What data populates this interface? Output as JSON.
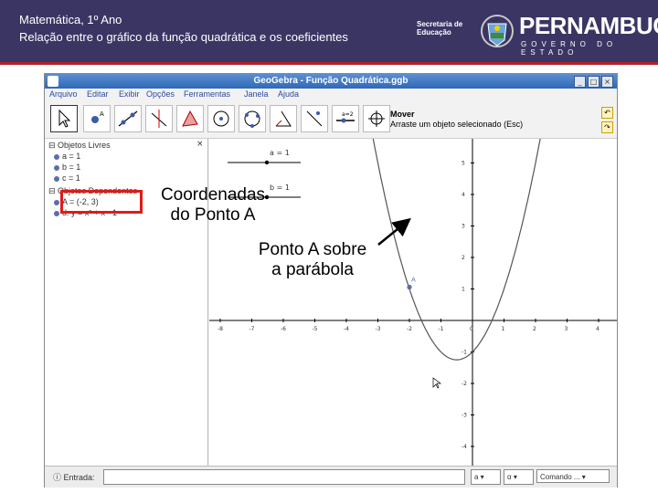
{
  "header": {
    "line1": "Matemática, 1º Ano",
    "line2": "Relação entre o gráfico da função quadrática e os coeficientes",
    "secretaria_line1": "Secretaria de",
    "secretaria_line2": "Educação",
    "brand": "PERNAMBUCO",
    "brand_sub": "GOVERNO DO ESTADO"
  },
  "window": {
    "title": "GeoGebra - Função Quadrática.ggb",
    "menu": [
      "Arquivo",
      "Editar",
      "Exibir",
      "Opções",
      "Ferramentas",
      "Janela",
      "Ajuda"
    ],
    "tool_title": "Mover",
    "tool_help": "Arraste um objeto selecionado (Esc)"
  },
  "algebra": {
    "free_header": "Objetos Livres",
    "free": [
      "a = 1",
      "b = 1",
      "c = 1"
    ],
    "dependent_header": "Objetos Dependentes",
    "dependent": [
      "A = (-2, 3)",
      "d: y = x² + x - 1"
    ]
  },
  "graphics": {
    "sliders": [
      "a = 1",
      "b = 1"
    ],
    "point_label": "A",
    "x_ticks": [
      "-8",
      "-7",
      "-6",
      "-5",
      "-4",
      "-3",
      "-2",
      "-1",
      "0",
      "1",
      "2",
      "3",
      "4"
    ],
    "y_ticks_pos": [
      "5",
      "4",
      "3",
      "2",
      "1"
    ],
    "y_ticks_neg": [
      "-1",
      "-2",
      "-3",
      "-4"
    ]
  },
  "input_bar": {
    "label": "Entrada:",
    "select1": "a",
    "select2": "α",
    "command": "Comando ..."
  },
  "annotations": {
    "coords_line1": "Coordenadas",
    "coords_line2": "do Ponto A",
    "point_line1": "Ponto A sobre",
    "point_line2": "a parábola"
  },
  "colors": {
    "header_bg": "#3b3564",
    "header_stripe": "#b52025",
    "highlight_box": "#e01a1a"
  }
}
